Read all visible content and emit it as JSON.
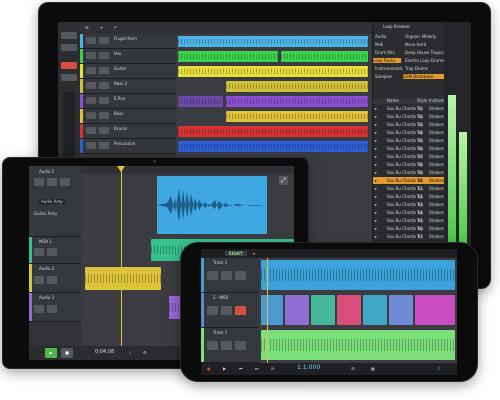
{
  "desktop": {
    "track_names": [
      "Flugel Horn",
      "Vox",
      "Guitar",
      "Bass 2",
      "E.Pno",
      "Bass",
      "Drums",
      "Percussion"
    ],
    "colors": {
      "track1": "#4db3e6",
      "track2": "#3bd24b",
      "track3": "#e7df3e",
      "track4": "#d1c13a",
      "track5": "#8c4fd1",
      "track6": "#e2c038",
      "track7": "#d93434",
      "track8": "#2c5fd6"
    },
    "loop_browser_title": "Loop Browser",
    "browser_left": [
      "Audio",
      "Midi",
      "Drum Kits",
      "Loop Packs",
      "Instrumentals",
      "Samples"
    ],
    "browser_folders": [
      "Organic Melody",
      "Nova Hard",
      "Deep House Tropical",
      "Electro Loop Drums",
      "Trap Drums",
      "EDM Beatdown"
    ],
    "browser_columns": [
      "Name",
      "Style",
      "Instrument"
    ],
    "browser_rows": [
      {
        "name": "Sou.Ru Chords 01",
        "style": "Trp",
        "instrument": "Strokes"
      },
      {
        "name": "Sou.Ru Chords 02",
        "style": "Trp",
        "instrument": "Strokes"
      },
      {
        "name": "Sou.Ru Chords 03",
        "style": "Trp",
        "instrument": "Strokes"
      },
      {
        "name": "Sou.Ru Chords 04",
        "style": "Trp",
        "instrument": "Strokes"
      },
      {
        "name": "Sou.Ru Chords 05",
        "style": "Trp",
        "instrument": "Strokes"
      },
      {
        "name": "Sou.Ru Chords 06",
        "style": "Trp",
        "instrument": "Strokes"
      },
      {
        "name": "Sou.Ru Chords 07",
        "style": "Trp",
        "instrument": "Strokes"
      },
      {
        "name": "Sou.Ru Chords 08",
        "style": "Trp",
        "instrument": "Strokes"
      },
      {
        "name": "Sou.Ru Chords 09",
        "style": "Trp",
        "instrument": "Strokes"
      },
      {
        "name": "Sou.Ru Chords 10",
        "style": "Trp",
        "instrument": "Strokes"
      },
      {
        "name": "Sou.Ru Chords 11",
        "style": "Trp",
        "instrument": "Strokes"
      },
      {
        "name": "Sou.Ru Chords 12",
        "style": "Trp",
        "instrument": "Strokes"
      },
      {
        "name": "Sou.Ru Chords 13",
        "style": "Trp",
        "instrument": "Strokes"
      },
      {
        "name": "Sou.Ru Chords 14",
        "style": "Trp",
        "instrument": "Strokes"
      },
      {
        "name": "Sou.Ru Chords 15",
        "style": "Trp",
        "instrument": "Strokes"
      },
      {
        "name": "Sou.Ru Chords 16",
        "style": "Trp",
        "instrument": "Strokes"
      },
      {
        "name": "Sou.Ru Chords 17",
        "style": "Trp",
        "instrument": "Strokes"
      },
      {
        "name": "Sou.Ru Chords 18",
        "style": "Trp",
        "instrument": "Strokes"
      }
    ],
    "selected_row": 9,
    "meter_levels": [
      0.7,
      0.55
    ]
  },
  "tablet": {
    "tracks": [
      "Audio 1",
      "MIDI 1",
      "Audio 2",
      "Audio 3"
    ],
    "fx_label": "Audio Amp",
    "fx_preset": "Guitar Amp",
    "time": "0:04.08",
    "colors": {
      "waveform": "#3fa8e0",
      "midi": "#36c28c",
      "audio_yellow": "#dcc43a",
      "audio_purple": "#9a66d8"
    }
  },
  "phone": {
    "title": "EIGHT",
    "tracks": [
      "Track 1",
      "2 - MIDI",
      "Track 1"
    ],
    "time": "1:1:000",
    "colors": {
      "top": "#3ba3da",
      "mid": "#5b8ad0",
      "bottom": "#7be07a"
    }
  }
}
